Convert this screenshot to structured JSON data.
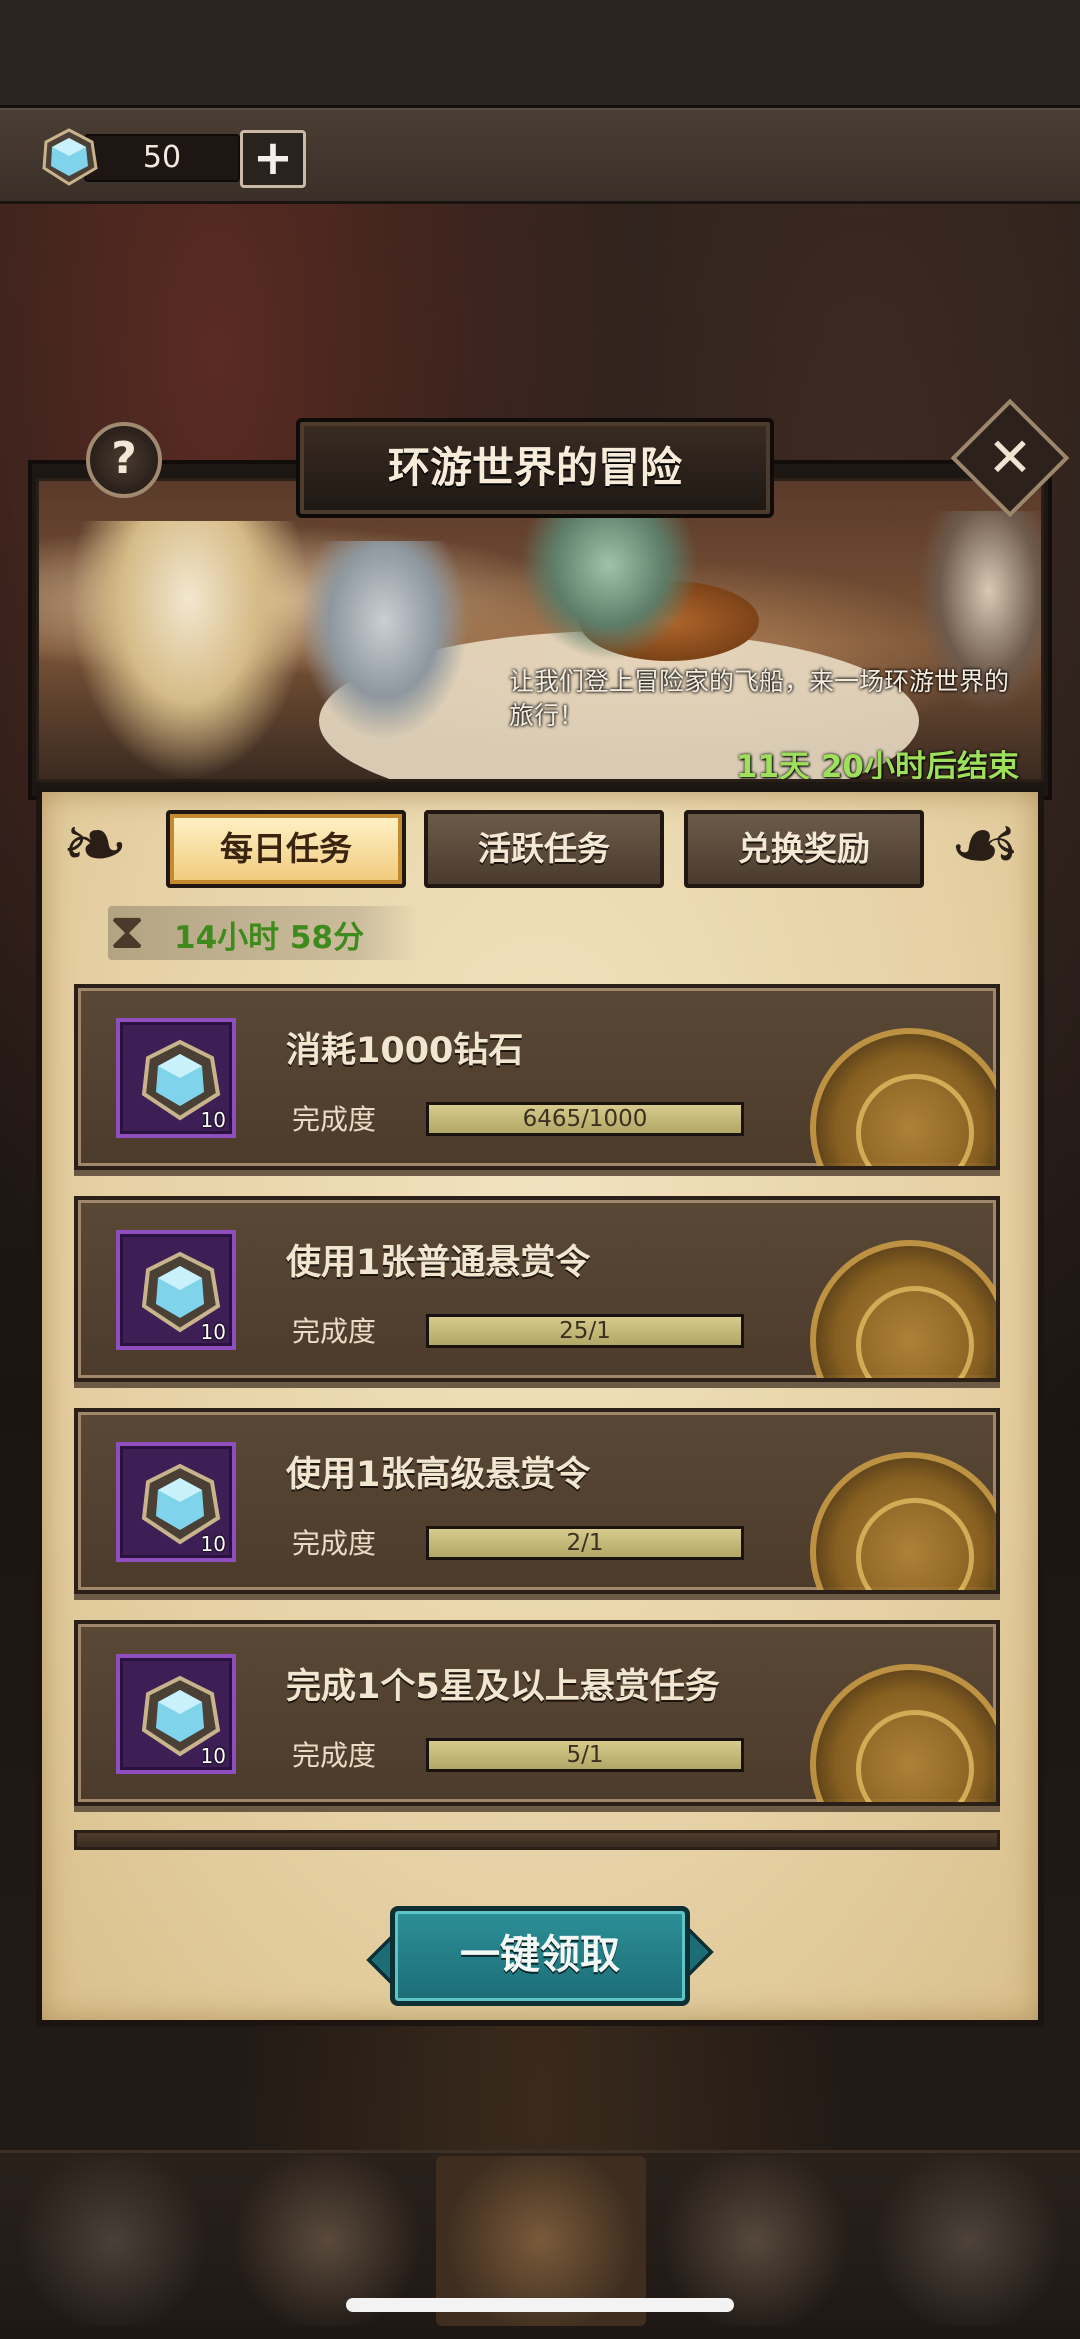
{
  "currency": {
    "gem_icon": "diamond-gem-icon",
    "amount": "50",
    "add_label": "+"
  },
  "panel": {
    "title": "环游世界的冒险",
    "help_label": "?",
    "close_label": "✕",
    "banner_description": "让我们登上冒险家的飞船，来一场环游世界的旅行！",
    "banner_time_left": "11天 20小时后结束"
  },
  "tabs": [
    {
      "label": "每日任务",
      "active": true
    },
    {
      "label": "活跃任务",
      "active": false
    },
    {
      "label": "兑换奖励",
      "active": false
    }
  ],
  "timer": {
    "icon": "hourglass-icon",
    "text": "14小时 58分"
  },
  "tasks": [
    {
      "title": "消耗1000钻石",
      "progress_label": "完成度",
      "progress_text": "6465/1000",
      "progress_fraction": 1.0,
      "reward_qty": "10",
      "reward_icon": "diamond-gem-icon"
    },
    {
      "title": "使用1张普通悬赏令",
      "progress_label": "完成度",
      "progress_text": "25/1",
      "progress_fraction": 1.0,
      "reward_qty": "10",
      "reward_icon": "diamond-gem-icon"
    },
    {
      "title": "使用1张高级悬赏令",
      "progress_label": "完成度",
      "progress_text": "2/1",
      "progress_fraction": 1.0,
      "reward_qty": "10",
      "reward_icon": "diamond-gem-icon"
    },
    {
      "title": "完成1个5星及以上悬赏任务",
      "progress_label": "完成度",
      "progress_text": "5/1",
      "progress_fraction": 1.0,
      "reward_qty": "10",
      "reward_icon": "diamond-gem-icon"
    }
  ],
  "claim_all_label": "一键领取",
  "colors": {
    "accent_teal": "#2d8f97",
    "timer_green": "#3f8a1d",
    "banner_timer_green": "#9fe05a",
    "reward_purple": "#8c4fbd"
  }
}
